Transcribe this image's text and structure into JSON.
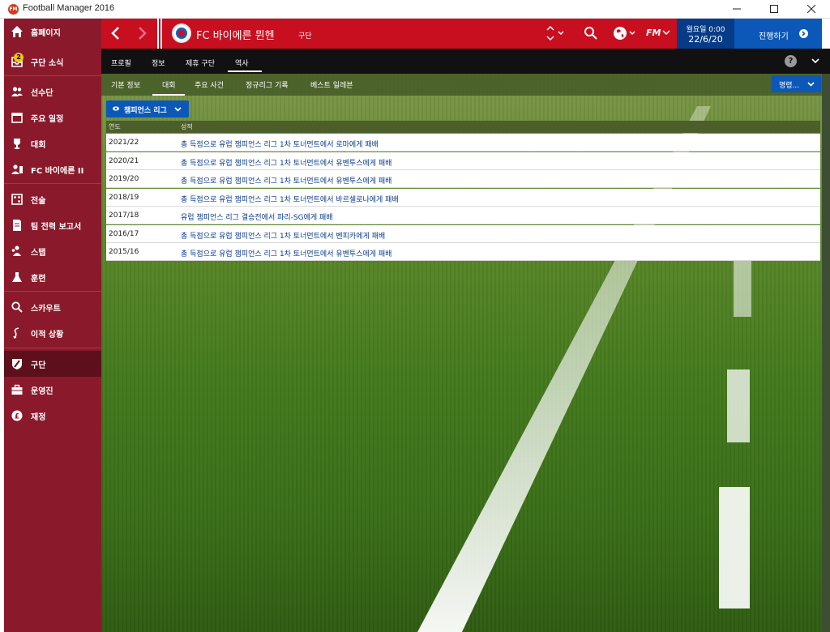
{
  "window": {
    "title": "Football Manager 2016",
    "logo_text": "FM"
  },
  "sidebar": {
    "badge": "2",
    "items": [
      {
        "label": "홈페이지",
        "icon": "home-icon"
      },
      {
        "label": "구단 소식",
        "icon": "inbox-icon"
      },
      {
        "label": "선수단",
        "icon": "squad-icon"
      },
      {
        "label": "주요 일정",
        "icon": "calendar-icon"
      },
      {
        "label": "대회",
        "icon": "trophy-icon"
      },
      {
        "label": "FC 바이에른 II",
        "icon": "reserve-team-icon"
      },
      {
        "label": "전술",
        "icon": "tactics-icon"
      },
      {
        "label": "팀 전력 보고서",
        "icon": "report-icon"
      },
      {
        "label": "스탭",
        "icon": "staff-icon"
      },
      {
        "label": "훈련",
        "icon": "training-icon"
      },
      {
        "label": "스카우트",
        "icon": "scout-search-icon"
      },
      {
        "label": "이적 상황",
        "icon": "transfer-icon"
      },
      {
        "label": "구단",
        "icon": "club-shield-icon"
      },
      {
        "label": "운영진",
        "icon": "briefcase-icon"
      },
      {
        "label": "재정",
        "icon": "finance-icon"
      }
    ]
  },
  "header": {
    "club_name": "FC 바이에른 뮌헨",
    "club_type": "구단",
    "day": "월요일 0:00",
    "date": "22/6/20",
    "continue_label": "진행하기",
    "fm_label": "FM"
  },
  "tabs": [
    {
      "label": "프로필"
    },
    {
      "label": "정보"
    },
    {
      "label": "제휴 구단"
    },
    {
      "label": "역사"
    }
  ],
  "help_label": "?",
  "subtabs": [
    {
      "label": "기본 정보"
    },
    {
      "label": "대회"
    },
    {
      "label": "주요 사건"
    },
    {
      "label": "정규리그 기록"
    },
    {
      "label": "베스트 일레븐"
    }
  ],
  "command_label": "명령...",
  "competition_dropdown": "챔피언스 리그",
  "table": {
    "headers": [
      "연도",
      "성적"
    ],
    "rows": [
      {
        "year": "2021/22",
        "result": "총 득점으로 유럽 챔피언스 리그 1차 토너먼트에서 로마에게 패배"
      },
      {
        "year": "2020/21",
        "result": "총 득점으로 유럽 챔피언스 리그 1차 토너먼트에서 유벤투스에게 패배"
      },
      {
        "year": "2019/20",
        "result": "총 득점으로 유럽 챔피언스 리그 1차 토너먼트에서 유벤투스에게 패배"
      },
      {
        "year": "2018/19",
        "result": "총 득점으로 유럽 챔피언스 리그 1차 토너먼트에서 바르셀로나에게 패배"
      },
      {
        "year": "2017/18",
        "result": "유럽 챔피언스 리그 결승전에서 파리-SG에게 패배"
      },
      {
        "year": "2016/17",
        "result": "총 득점으로 유럽 챔피언스 리그 1차 토너먼트에서 벤피카에게 패배"
      },
      {
        "year": "2015/16",
        "result": "총 득점으로 유럽 챔피언스 리그 1차 토너먼트에서 유벤투스에게 패배"
      }
    ]
  },
  "colors": {
    "sidebar": "#8a1a2b",
    "header": "#c80f1f",
    "accent_blue": "#0c58b8",
    "date_panel": "#063b87",
    "link_text": "#0b3c8c"
  }
}
